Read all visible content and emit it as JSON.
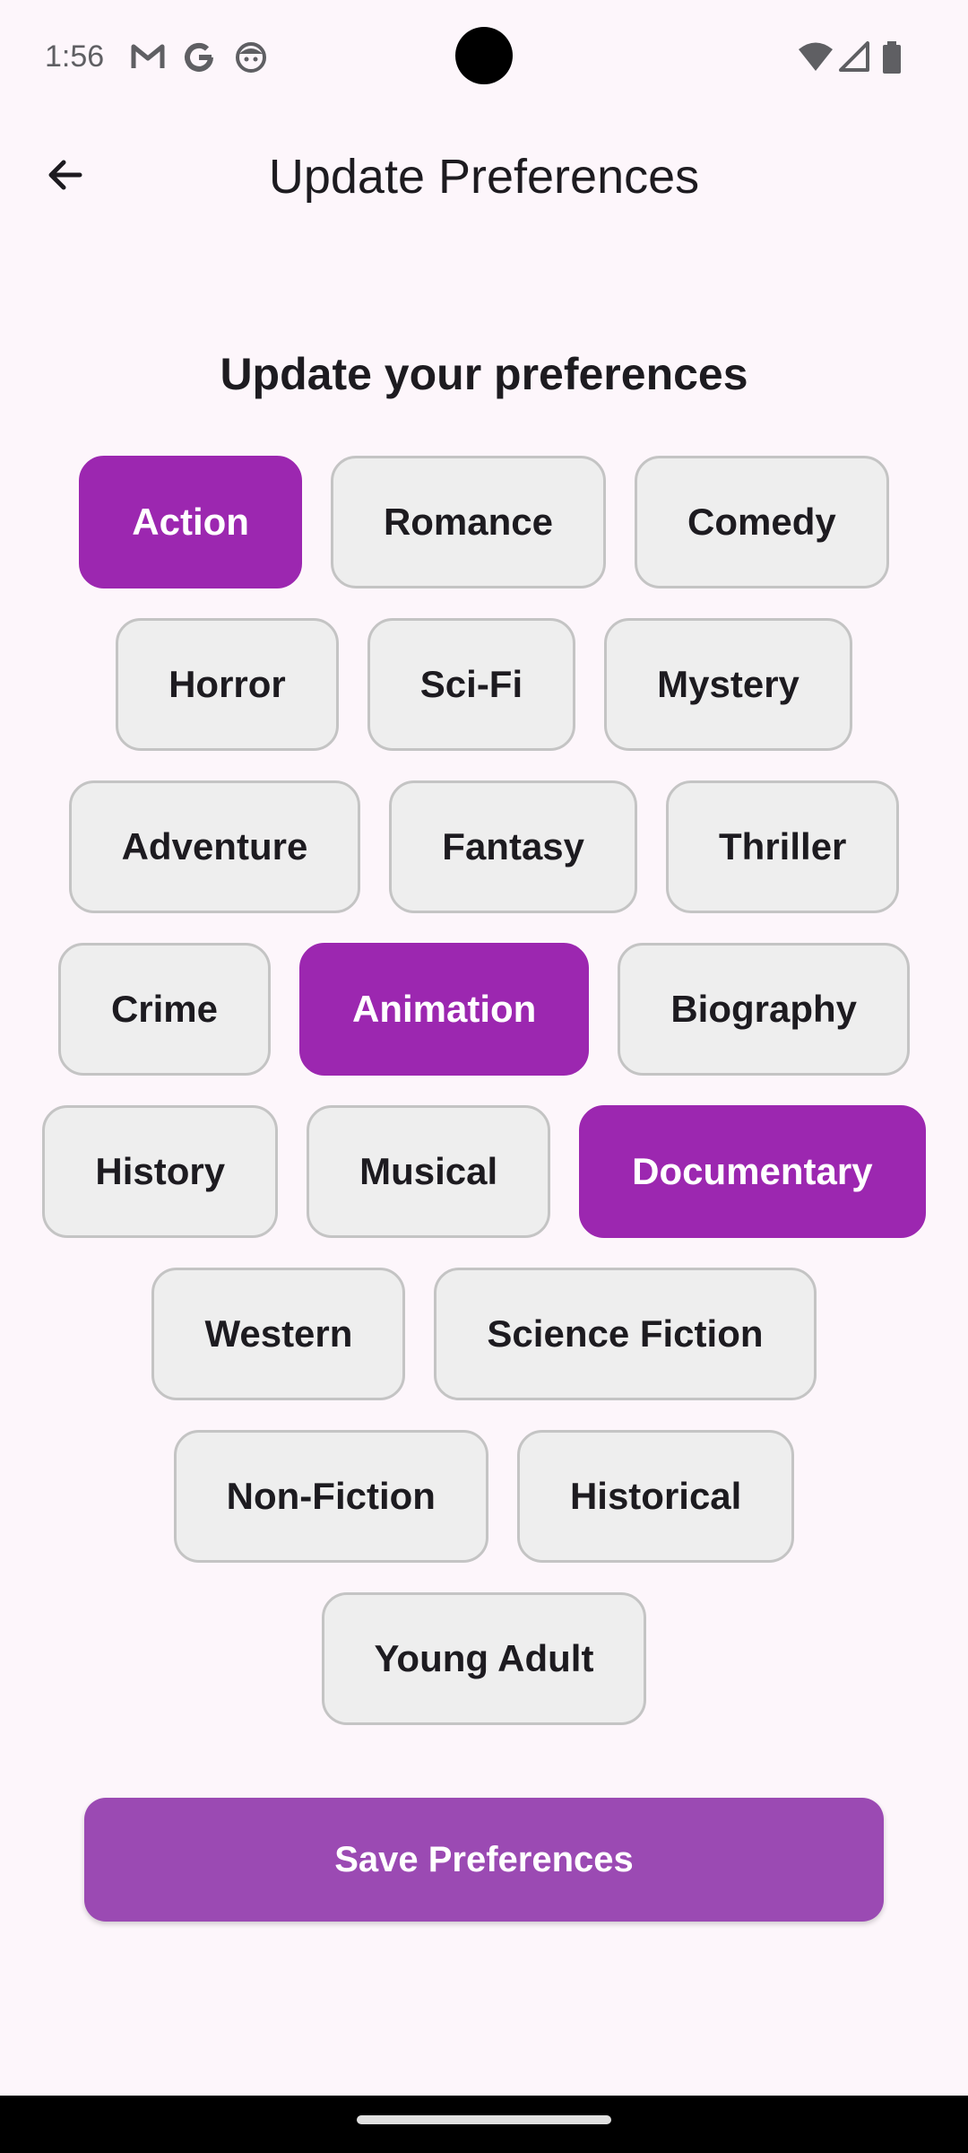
{
  "status_bar": {
    "time": "1:56",
    "left_icons": [
      "gmail-icon",
      "google-icon",
      "face-icon"
    ],
    "right_icons": [
      "wifi-icon",
      "signal-icon",
      "battery-icon"
    ]
  },
  "app_bar": {
    "back_icon": "arrow-back-icon",
    "title": "Update Preferences"
  },
  "heading": "Update your preferences",
  "colors": {
    "selected_chip": "#9c27b0",
    "save_button": "#9b4ab3",
    "background": "#fdf6fb"
  },
  "chip_rows": [
    [
      {
        "label": "Action",
        "selected": true
      },
      {
        "label": "Romance",
        "selected": false
      },
      {
        "label": "Comedy",
        "selected": false
      }
    ],
    [
      {
        "label": "Horror",
        "selected": false
      },
      {
        "label": "Sci-Fi",
        "selected": false
      },
      {
        "label": "Mystery",
        "selected": false
      }
    ],
    [
      {
        "label": "Adventure",
        "selected": false
      },
      {
        "label": "Fantasy",
        "selected": false
      },
      {
        "label": "Thriller",
        "selected": false
      }
    ],
    [
      {
        "label": "Crime",
        "selected": false
      },
      {
        "label": "Animation",
        "selected": true
      },
      {
        "label": "Biography",
        "selected": false
      }
    ],
    [
      {
        "label": "History",
        "selected": false
      },
      {
        "label": "Musical",
        "selected": false
      },
      {
        "label": "Documentary",
        "selected": true
      }
    ],
    [
      {
        "label": "Western",
        "selected": false
      },
      {
        "label": "Science Fiction",
        "selected": false
      }
    ],
    [
      {
        "label": "Non-Fiction",
        "selected": false
      },
      {
        "label": "Historical",
        "selected": false
      }
    ],
    [
      {
        "label": "Young Adult",
        "selected": false
      }
    ]
  ],
  "save_button": {
    "label": "Save Preferences"
  }
}
